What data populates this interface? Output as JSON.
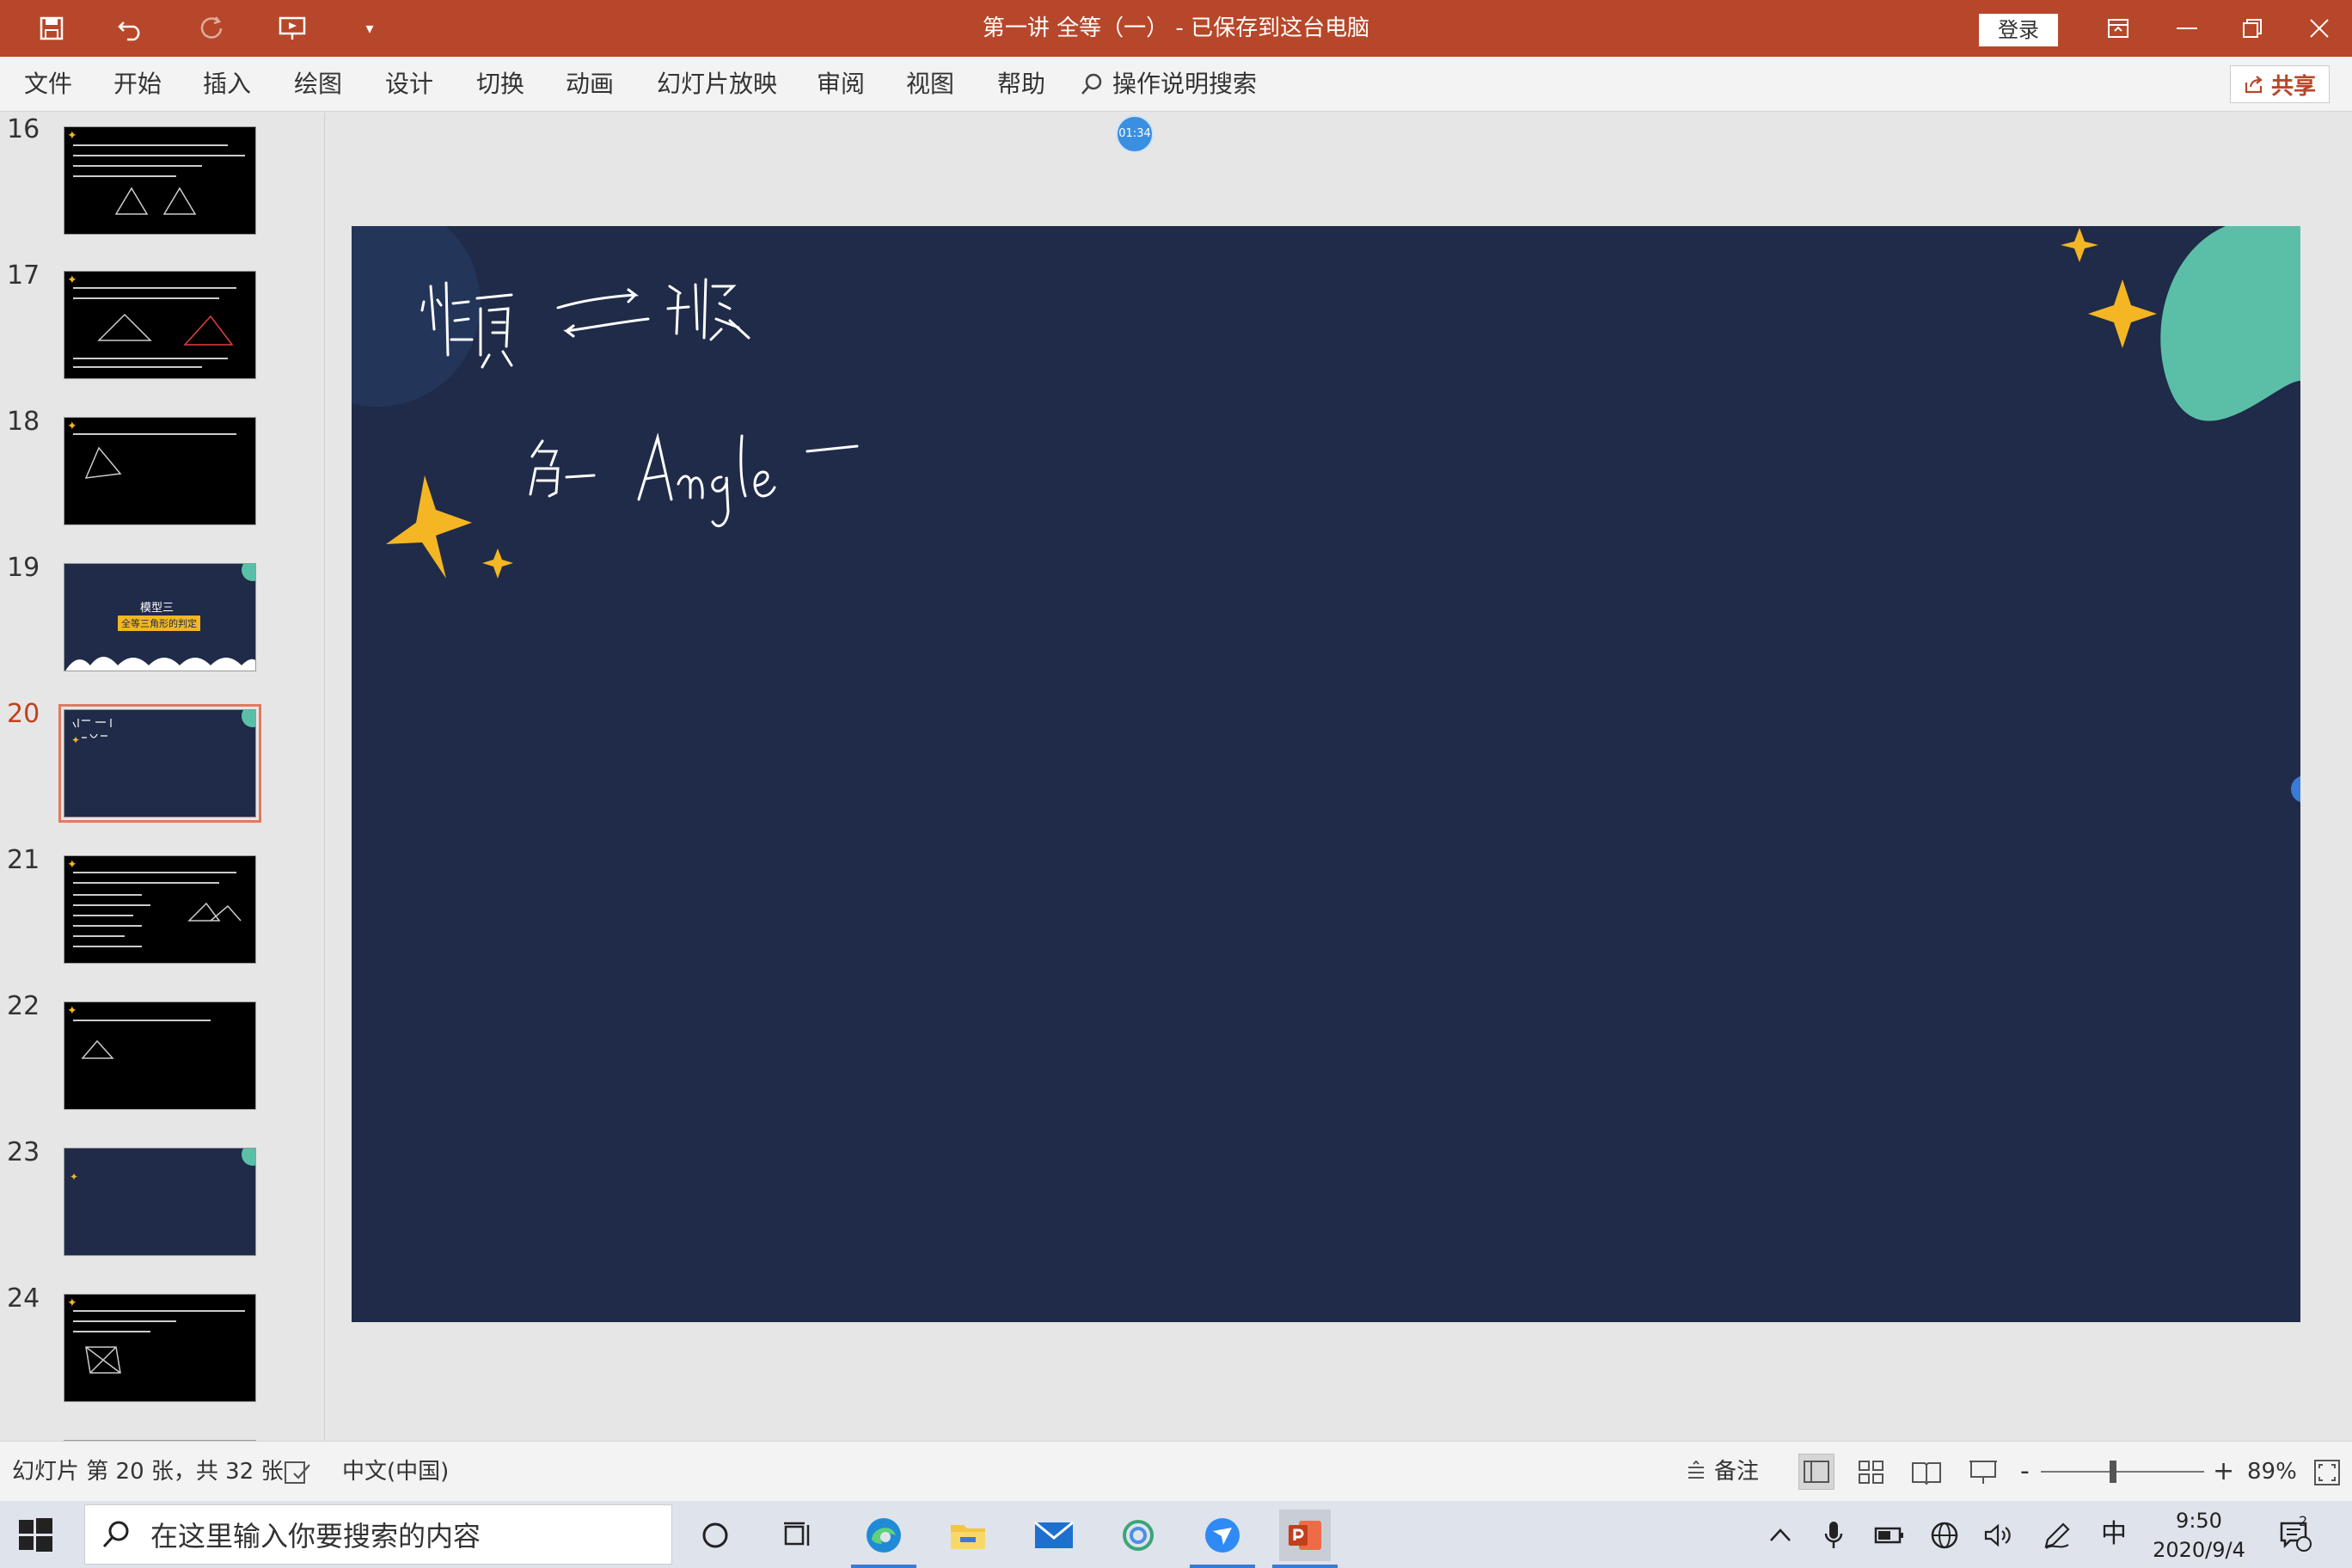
{
  "titlebar": {
    "title": "第一讲 全等（一） - 已保存到这台电脑",
    "login_label": "登录"
  },
  "ribbon": {
    "tabs": [
      "文件",
      "开始",
      "插入",
      "绘图",
      "设计",
      "切换",
      "动画",
      "幻灯片放映",
      "审阅",
      "视图",
      "帮助"
    ],
    "tell_me": "操作说明搜索",
    "share_label": "共享"
  },
  "thumbnails": {
    "numbers": [
      "16",
      "17",
      "18",
      "19",
      "20",
      "21",
      "22",
      "23",
      "24"
    ],
    "active": "20",
    "slide19_title": "模型三",
    "slide19_subtitle": "全等三角形的判定"
  },
  "timer": "01:34",
  "slide": {
    "background": "#1f2b48",
    "accent_yellow": "#f4b623",
    "accent_teal": "#5bbfa8"
  },
  "statusbar": {
    "slide_info": "幻灯片 第 20 张，共 32 张",
    "language": "中文(中国)",
    "notes_label": "备注",
    "zoom": "89%",
    "zoom_minus": "-",
    "zoom_plus": "+"
  },
  "taskbar": {
    "search_placeholder": "在这里输入你要搜索的内容",
    "ime": "中",
    "time": "9:50",
    "date": "2020/9/4",
    "notification_count": "2"
  }
}
